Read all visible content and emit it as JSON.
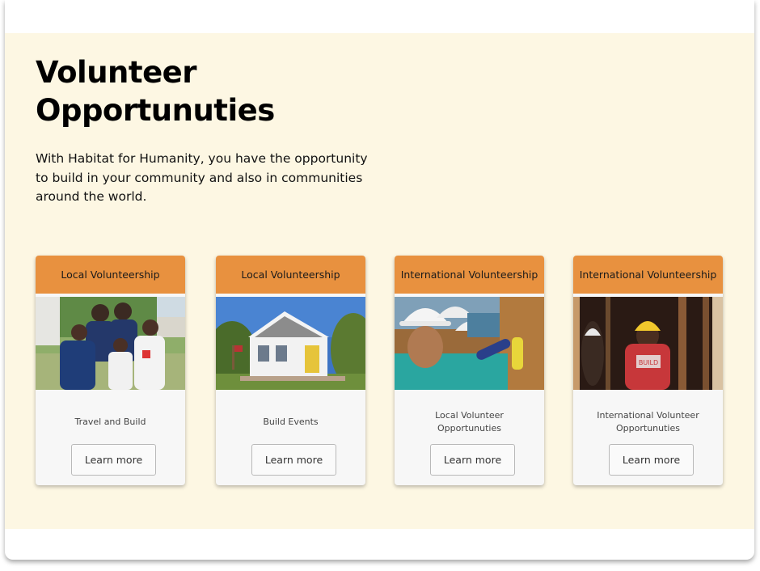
{
  "page": {
    "title": "Volunteer Opportunuties",
    "intro": "With Habitat for Humanity, you have the opportunity to build in your community and also in communities around the world.",
    "colors": {
      "band": "#fdf7e3",
      "card_header": "#e8913f",
      "card_body": "#f7f7f7"
    }
  },
  "cards": [
    {
      "header": "Local Volunteership",
      "photo": "family-volunteers-photo",
      "description": "Travel and Build",
      "button": "Learn more"
    },
    {
      "header": "Local Volunteership",
      "photo": "white-house-photo",
      "description": "Build Events",
      "button": "Learn more"
    },
    {
      "header": "International Volunteership",
      "photo": "hardhat-volunteers-photo",
      "description": "Local Volunteer Opportunuties",
      "button": "Learn more"
    },
    {
      "header": "International Volunteership",
      "photo": "women-build-photo",
      "description": "International Volunteer Opportunuties",
      "button": "Learn more"
    }
  ]
}
